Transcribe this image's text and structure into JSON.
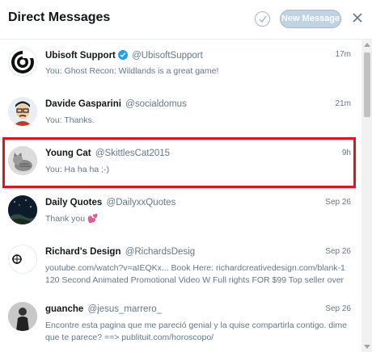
{
  "header": {
    "title": "Direct Messages",
    "mark_all_read_icon": "check-circle-icon",
    "new_message_label": "New Message",
    "close_icon": "close-icon"
  },
  "conversations": [
    {
      "name": "Ubisoft Support",
      "verified": true,
      "handle": "@UbisoftSupport",
      "time": "17m",
      "preview": "You: Ghost Recon: Wildlands is a great game!",
      "avatar_icon": "ubisoft-swirl-logo"
    },
    {
      "name": "Davide Gasparini",
      "handle": "@socialdomus",
      "time": "21m",
      "preview": "You: Thanks.",
      "avatar_icon": "cartoon-man-avatar"
    },
    {
      "name": "Young Cat",
      "handle": "@SkittlesCat2015",
      "time": "9h",
      "preview": "You: Ha ha ha ;-)",
      "avatar_icon": "cat-photo-avatar"
    },
    {
      "name": "Daily Quotes",
      "handle": "@DailyxxQuotes",
      "time": "Sep 26",
      "preview": "Thank you",
      "emoji": "💕",
      "avatar_icon": "night-sky-avatar"
    },
    {
      "name": "Richard's Design",
      "handle": "@RichardsDesig",
      "time": "Sep 26",
      "preview": "youtube.com/watch?v=aIEQKx... Book Here: richardcreativedesign.com/blank-1 120 Second Animated Promotional Video W Full rights FOR $99 Top seller over",
      "avatar_icon": "richards-creative-logo",
      "avatar_text": "RICH CRE"
    },
    {
      "name": "guanche",
      "handle": "@jesus_marrero_",
      "time": "Sep 26",
      "preview": "Encontre esta pagina que me pareció genial y la quise compartirla contigo. dime que te parece? ==> publituit.com/horoscopo/",
      "avatar_icon": "bw-figure-avatar"
    }
  ],
  "colors": {
    "accent": "#1da1f2",
    "highlight_border": "#e0141f",
    "new_message_bg": "#bfd3e1"
  }
}
